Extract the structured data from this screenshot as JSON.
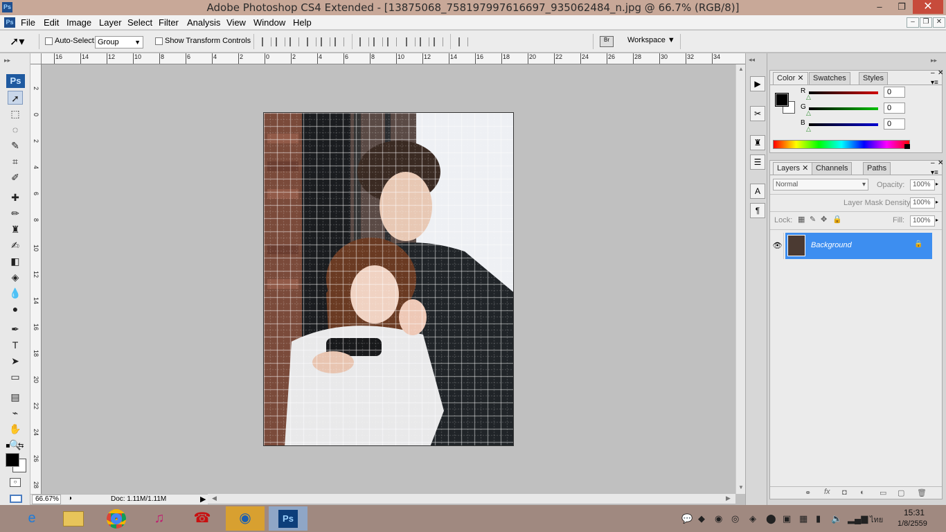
{
  "window": {
    "title": "Adobe Photoshop CS4 Extended - [13875068_758197997616697_935062484_n.jpg @ 66.7% (RGB/8)]",
    "ps_badge": "Ps",
    "minimize": "–",
    "maximize": "❐",
    "close": "✕"
  },
  "menubar": {
    "items": [
      "File",
      "Edit",
      "Image",
      "Layer",
      "Select",
      "Filter",
      "Analysis",
      "View",
      "Window",
      "Help"
    ],
    "doc_controls": [
      "–",
      "❐",
      "✕"
    ]
  },
  "options": {
    "auto_select_label": "Auto-Select:",
    "auto_select_value": "Group",
    "show_transform_label": "Show Transform Controls",
    "workspace_label": "Workspace ▼"
  },
  "toolbar": {
    "ps_badge": "Ps",
    "tools": [
      {
        "name": "move-tool",
        "glyph": "➚"
      },
      {
        "name": "marquee-tool",
        "glyph": "⬚"
      },
      {
        "name": "lasso-tool",
        "glyph": "◌"
      },
      {
        "name": "quick-selection-tool",
        "glyph": "✎"
      },
      {
        "name": "crop-tool",
        "glyph": "⌗"
      },
      {
        "name": "slice-tool",
        "glyph": "✐"
      },
      {
        "name": "healing-brush-tool",
        "glyph": "✚"
      },
      {
        "name": "brush-tool",
        "glyph": "✏"
      },
      {
        "name": "clone-stamp-tool",
        "glyph": "♜"
      },
      {
        "name": "history-brush-tool",
        "glyph": "✍"
      },
      {
        "name": "eraser-tool",
        "glyph": "◧"
      },
      {
        "name": "paint-bucket-tool",
        "glyph": "◈"
      },
      {
        "name": "blur-tool",
        "glyph": "💧"
      },
      {
        "name": "dodge-tool",
        "glyph": "●"
      },
      {
        "name": "pen-tool",
        "glyph": "✒"
      },
      {
        "name": "type-tool",
        "glyph": "T"
      },
      {
        "name": "path-selection-tool",
        "glyph": "➤"
      },
      {
        "name": "rectangle-tool",
        "glyph": "▭"
      },
      {
        "name": "notes-tool",
        "glyph": "▤"
      },
      {
        "name": "eyedropper-tool",
        "glyph": "⌁"
      },
      {
        "name": "hand-tool",
        "glyph": "✋"
      },
      {
        "name": "zoom-tool",
        "glyph": "🔍"
      }
    ]
  },
  "rulers": {
    "top": [
      "16",
      "14",
      "12",
      "10",
      "8",
      "6",
      "4",
      "2",
      "0",
      "2",
      "4",
      "6",
      "8",
      "10",
      "12",
      "14",
      "16",
      "18",
      "20",
      "22",
      "24",
      "26",
      "28",
      "30",
      "32",
      "34"
    ],
    "left": [
      "2",
      "0",
      "2",
      "4",
      "6",
      "8",
      "10",
      "12",
      "14",
      "16",
      "18",
      "20",
      "22",
      "24",
      "26",
      "28"
    ]
  },
  "status": {
    "zoom": "66.67%",
    "doc": "Doc: 1.11M/1.11M"
  },
  "color_panel": {
    "tabs": [
      "Color",
      "Swatches",
      "Styles"
    ],
    "channels": [
      {
        "label": "R",
        "value": "0",
        "color": "#d00000"
      },
      {
        "label": "G",
        "value": "0",
        "color": "#00c000"
      },
      {
        "label": "B",
        "value": "0",
        "color": "#0000d0"
      }
    ]
  },
  "layers_panel": {
    "tabs": [
      "Layers",
      "Channels",
      "Paths"
    ],
    "blend_mode": "Normal",
    "opacity_label": "Opacity:",
    "opacity_value": "100%",
    "mask_density_label": "Layer Mask Density",
    "mask_density_value": "100%",
    "lock_label": "Lock:",
    "fill_label": "Fill:",
    "fill_value": "100%",
    "layers": [
      {
        "name": "Background",
        "visible": true,
        "locked": true
      }
    ]
  },
  "taskbar": {
    "apps": [
      "internet-explorer-icon",
      "file-explorer-icon",
      "chrome-icon",
      "itunes-icon",
      "app-red-icon",
      "app-orange-icon",
      "photoshop-icon"
    ],
    "ps_label": "Ps",
    "lang": "ไทย",
    "time": "15:31",
    "date": "1/8/2559"
  }
}
